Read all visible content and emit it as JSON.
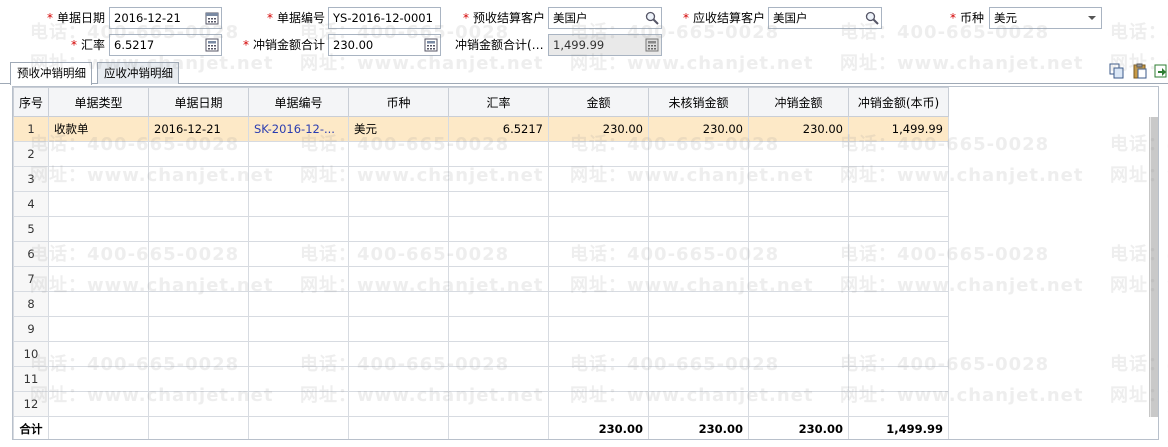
{
  "form": {
    "doc_date": {
      "label": "单据日期",
      "value": "2016-12-21"
    },
    "doc_no": {
      "label": "单据编号",
      "value": "YS-2016-12-0001"
    },
    "prepay_customer": {
      "label": "预收结算客户",
      "value": "美国户"
    },
    "receivable_customer": {
      "label": "应收结算客户",
      "value": "美国户"
    },
    "currency": {
      "label": "币种",
      "value": "美元"
    },
    "rate": {
      "label": "汇率",
      "value": "6.5217"
    },
    "offset_total": {
      "label": "冲销金额合计",
      "value": "230.00"
    },
    "offset_total_local": {
      "label": "冲销金额合计(…",
      "value": "1,499.99"
    }
  },
  "tabs": [
    {
      "label": "预收冲销明细",
      "active": true
    },
    {
      "label": "应收冲销明细",
      "active": false
    }
  ],
  "toolbar": {
    "icons": [
      "copy-icon",
      "paste-icon",
      "export-icon"
    ]
  },
  "table": {
    "headers": [
      "序号",
      "单据类型",
      "单据日期",
      "单据编号",
      "币种",
      "汇率",
      "金额",
      "未核销金额",
      "冲销金额",
      "冲销金额(本币)"
    ],
    "rows": [
      {
        "seq": "1",
        "type": "收款单",
        "date": "2016-12-21",
        "no": "SK-2016-12-...",
        "currency": "美元",
        "rate": "6.5217",
        "amount": "230.00",
        "unverified": "230.00",
        "offset": "230.00",
        "offset_local": "1,499.99"
      },
      {
        "seq": "2"
      },
      {
        "seq": "3"
      },
      {
        "seq": "4"
      },
      {
        "seq": "5"
      },
      {
        "seq": "6"
      },
      {
        "seq": "7"
      },
      {
        "seq": "8"
      },
      {
        "seq": "9"
      },
      {
        "seq": "10"
      },
      {
        "seq": "11"
      },
      {
        "seq": "12"
      }
    ],
    "total": {
      "label": "合计",
      "amount": "230.00",
      "unverified": "230.00",
      "offset": "230.00",
      "offset_local": "1,499.99"
    }
  },
  "watermark": {
    "phone": "电话：400-665-0028",
    "site": "网址：www.chanjet.net"
  },
  "colors": {
    "required": "#d40000",
    "selected_row": "#fde9c7",
    "link": "#2a3cb0"
  }
}
